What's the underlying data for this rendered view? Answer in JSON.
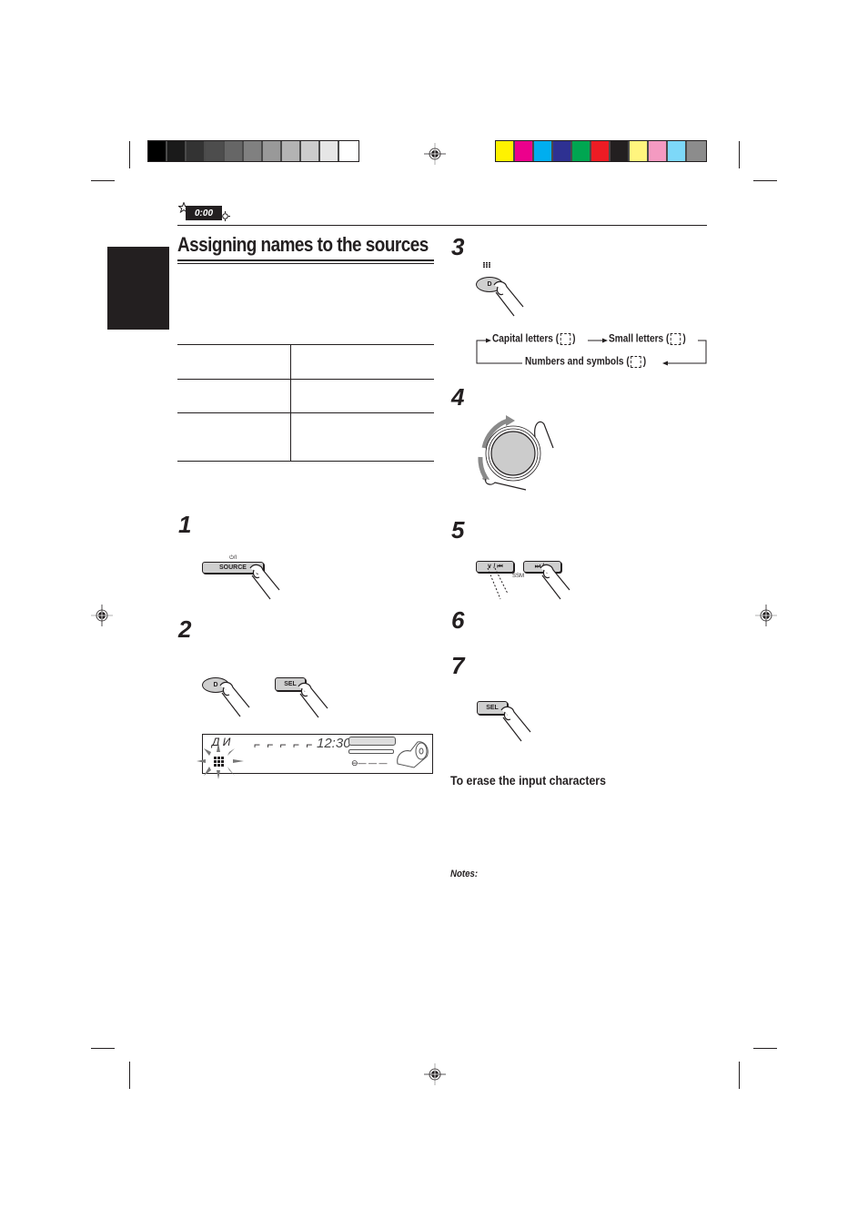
{
  "print_marks": {
    "grayscale_swatches": [
      "#000000",
      "#1a1a1a",
      "#333333",
      "#4d4d4d",
      "#666666",
      "#808080",
      "#999999",
      "#b3b3b3",
      "#cccccc",
      "#e6e6e6",
      "#ffffff"
    ],
    "color_swatches": [
      "#fff200",
      "#ec008c",
      "#00aeef",
      "#2e3192",
      "#00a651",
      "#ed1c24",
      "#231f20",
      "#fff57e",
      "#f49ac1",
      "#7dd8f8",
      "#8c8c8c"
    ]
  },
  "header": {
    "clock_icon_text": "0:00"
  },
  "page": {
    "title": "Assigning names to the sources"
  },
  "source_table": {
    "rows": [
      {
        "col1": "",
        "col2": ""
      },
      {
        "col1": "",
        "col2": ""
      },
      {
        "col1": "",
        "col2": ""
      }
    ]
  },
  "steps": [
    {
      "number": "1",
      "buttons": [
        {
          "label": "SOURCE",
          "top_label": "⏻/I"
        }
      ]
    },
    {
      "number": "2",
      "buttons": [
        {
          "label": "D"
        },
        {
          "label": "SEL"
        }
      ]
    },
    {
      "number": "3",
      "buttons": [
        {
          "label": "D"
        }
      ]
    },
    {
      "number": "4",
      "buttons": []
    },
    {
      "number": "5",
      "buttons": [
        {
          "label": "∨ / ⏮"
        },
        {
          "label": "⏭ / ∧"
        }
      ],
      "ssm_label": "SSM"
    },
    {
      "number": "6",
      "buttons": []
    },
    {
      "number": "7",
      "buttons": [
        {
          "label": "SEL"
        }
      ]
    }
  ],
  "character_modes": {
    "capital": "Capital letters (",
    "small": "Small letters (",
    "numbers": "Numbers and symbols (",
    "close_paren": ")"
  },
  "lcd_display": {
    "source_chars": "Д И",
    "time": "12:30"
  },
  "sections": {
    "erase_heading": "To erase the input characters",
    "notes_heading": "Notes:"
  }
}
